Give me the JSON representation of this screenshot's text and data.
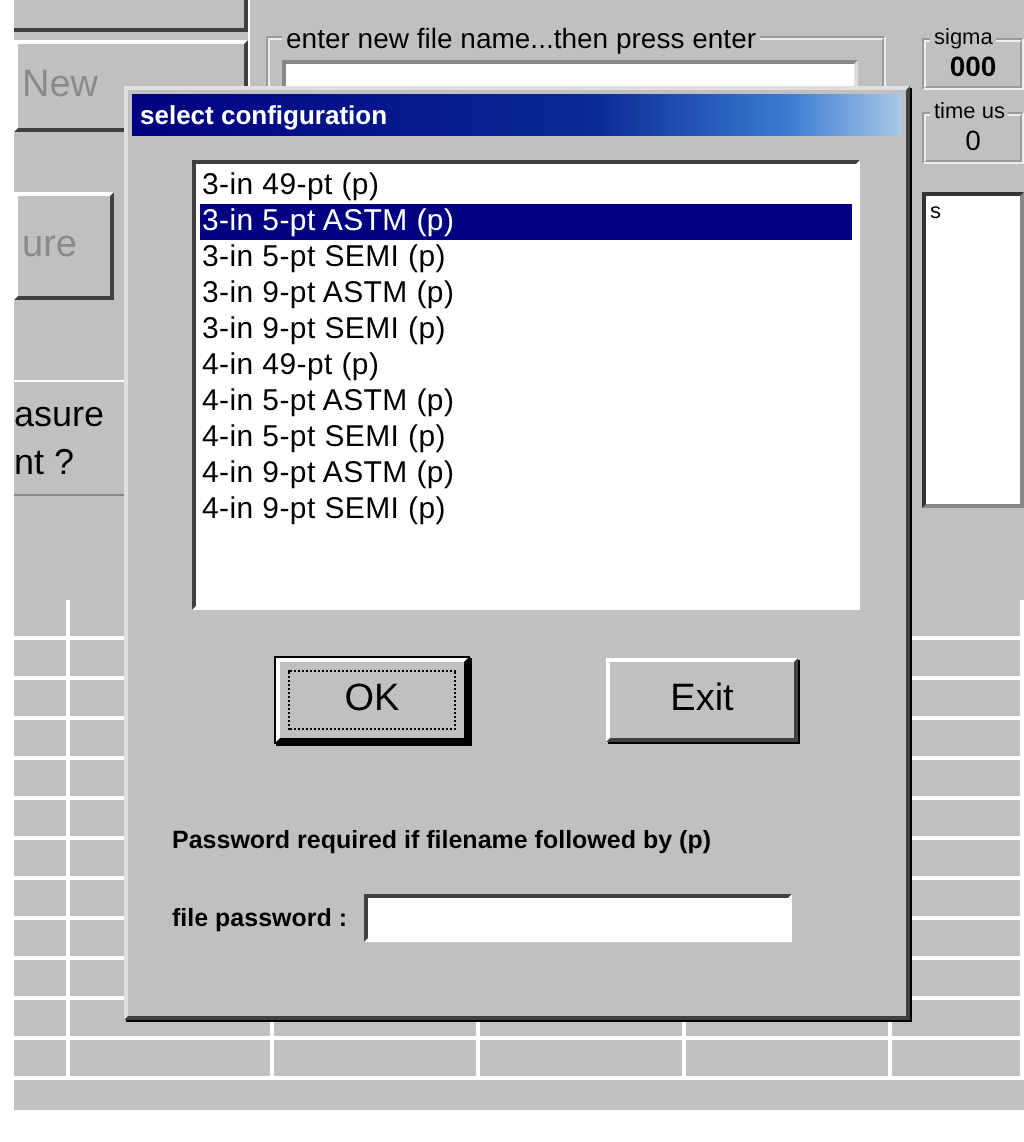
{
  "background": {
    "new_file_button": {
      "label": "New",
      "disabled": true
    },
    "measure_button": {
      "label": "ure",
      "disabled": true
    },
    "prompt_lines": [
      "asure",
      "nt ?"
    ],
    "file_name_group": {
      "label": "enter new file name...then press enter"
    },
    "sigma": {
      "label": "sigma",
      "value": "000"
    },
    "time_used": {
      "label": "time us",
      "value": "0"
    },
    "notes_panel": {
      "text": "s"
    }
  },
  "dialog": {
    "title": "select configuration",
    "items": [
      {
        "label": "3-in 49-pt (p)",
        "selected": false
      },
      {
        "label": "3-in 5-pt ASTM (p)",
        "selected": true
      },
      {
        "label": "3-in 5-pt SEMI (p)",
        "selected": false
      },
      {
        "label": "3-in 9-pt ASTM (p)",
        "selected": false
      },
      {
        "label": "3-in 9-pt SEMI (p)",
        "selected": false
      },
      {
        "label": "4-in 49-pt (p)",
        "selected": false
      },
      {
        "label": "4-in 5-pt ASTM (p)",
        "selected": false
      },
      {
        "label": "4-in 5-pt SEMI (p)",
        "selected": false
      },
      {
        "label": "4-in 9-pt ASTM (p)",
        "selected": false
      },
      {
        "label": "4-in 9-pt SEMI (p)",
        "selected": false
      }
    ],
    "buttons": [
      {
        "label": "OK",
        "focused": true
      },
      {
        "label": "Exit",
        "focused": false
      }
    ],
    "note": "Password required if filename followed by (p)",
    "password": {
      "label": "file password :"
    }
  }
}
